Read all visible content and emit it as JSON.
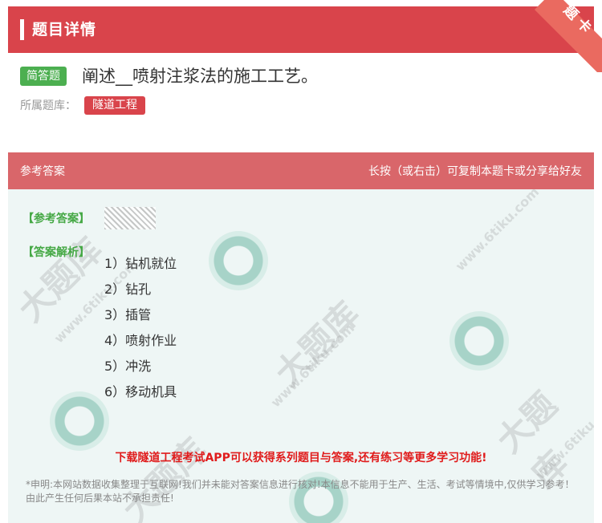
{
  "header": {
    "title": "题目详情",
    "ribbon": "题卡"
  },
  "question": {
    "type_tag": "简答题",
    "text": "阐述__喷射注浆法的施工工艺。",
    "bank_label": "所属题库：",
    "bank_name": "隧道工程"
  },
  "answer": {
    "head_left": "参考答案",
    "head_right": "长按（或右击）可复制本题卡或分享给好友",
    "ref_label": "【参考答案】",
    "analysis_label": "【答案解析】",
    "steps": [
      "1）钻机就位",
      "2）钻孔",
      "3）插管",
      "4）喷射作业",
      "5）冲洗",
      "6）移动机具"
    ],
    "promo": "下载隧道工程考试APP可以获得系列题目与答案,还有练习等更多学习功能!",
    "disclaimer": "*申明:本网站数据收集整理于互联网!我们并未能对答案信息进行核对!本信息不能用于生产、生活、考试等情境中,仅供学习参考！由此产生任何后果本站不承担责任!"
  },
  "watermark": {
    "brand": "大题库",
    "site": "www.6tiku.com"
  },
  "colors": {
    "header_red": "#d9444b",
    "answer_head": "#d9666a",
    "green": "#4caf50",
    "promo_red": "#e01b1b"
  }
}
